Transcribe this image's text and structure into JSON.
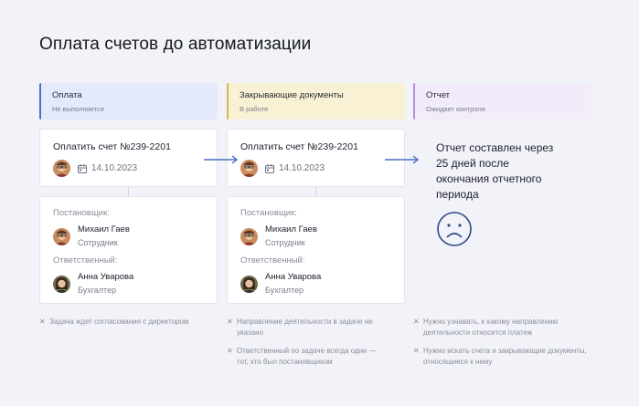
{
  "title": "Оплата счетов до автоматизации",
  "columns": [
    {
      "stage": {
        "title": "Оплата",
        "status": "Не выполняется"
      },
      "invoice": {
        "title": "Оплатить счет №239-2201",
        "date": "14.10.2023"
      },
      "assignee_label": "Постановщик:",
      "assignee": {
        "name": "Михаил Гаев",
        "role": "Сотрудник"
      },
      "responsible_label": "Ответственный:",
      "responsible": {
        "name": "Анна Уварова",
        "role": "Бухгалтер"
      },
      "notes": [
        "Задача ждет согласования с директором"
      ]
    },
    {
      "stage": {
        "title": "Закрывающие документы",
        "status": "В работе"
      },
      "invoice": {
        "title": "Оплатить счет №239-2201",
        "date": "14.10.2023"
      },
      "assignee_label": "Постановщик:",
      "assignee": {
        "name": "Михаил Гаев",
        "role": "Сотрудник"
      },
      "responsible_label": "Ответственный:",
      "responsible": {
        "name": "Анна Уварова",
        "role": "Бухгалтер"
      },
      "notes": [
        "Направление деятельности в задаче не указано",
        "Ответственный по задаче всегда один — тот, кто был постановщиком"
      ]
    },
    {
      "stage": {
        "title": "Отчет",
        "status": "Ожидает контроля"
      },
      "report_text": "Отчет составлен через 25 дней после окончания отчетного периода",
      "notes": [
        "Нужно узнавать, к какому направлению деятельности относится платеж",
        "Нужно искать счета и закрывающие документы, относящиеся к нему"
      ]
    }
  ],
  "icons": {
    "arrow": "arrow-right-icon",
    "calendar": "calendar-icon",
    "sad": "sad-face-icon",
    "note_marker": "cross-icon"
  },
  "colors": {
    "stage_payment": "#e4eaf9",
    "stage_documents": "#f8f1d4",
    "stage_report": "#f1ebfa",
    "accent_arrow": "#4a6fc8"
  }
}
